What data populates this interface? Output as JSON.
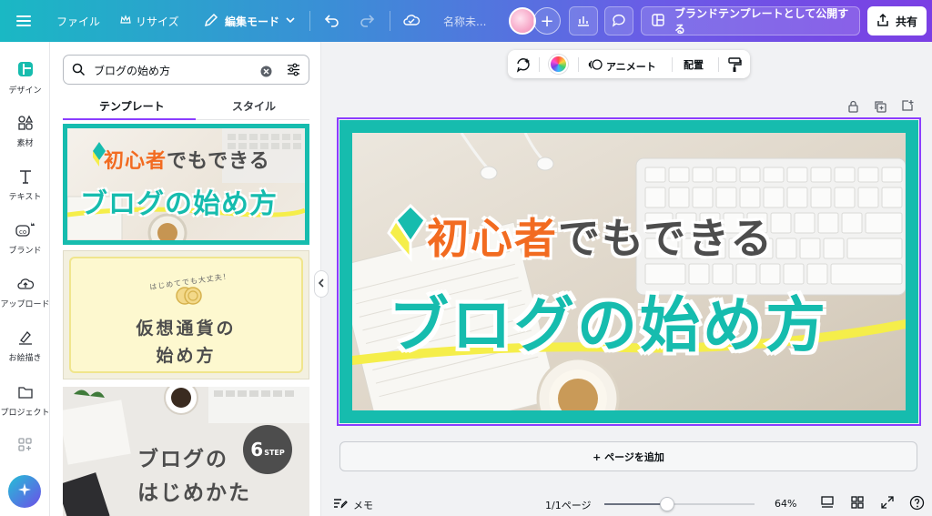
{
  "topbar": {
    "menu_label": "ファイル",
    "resize_label": "リサイズ",
    "mode_label": "編集モード",
    "doc_name": "名称未...",
    "publish_label": "ブランドテンプレートとして公開する",
    "share_label": "共有"
  },
  "rail": {
    "items": [
      {
        "label": "デザイン",
        "icon": "design-icon"
      },
      {
        "label": "素材",
        "icon": "elements-icon"
      },
      {
        "label": "テキスト",
        "icon": "text-icon"
      },
      {
        "label": "ブランド",
        "icon": "brand-icon"
      },
      {
        "label": "アップロード",
        "icon": "upload-icon"
      },
      {
        "label": "お絵描き",
        "icon": "draw-icon"
      },
      {
        "label": "プロジェクト",
        "icon": "folder-icon"
      }
    ]
  },
  "panel": {
    "search_value": "ブログの始め方",
    "tabs": [
      {
        "label": "テンプレート"
      },
      {
        "label": "スタイル"
      }
    ],
    "templates": [
      {
        "line1": "初心者でもできる",
        "line2": "ブログの始め方"
      },
      {
        "badge": "はじめてでも大丈夫！",
        "line1": "仮想通貨の",
        "line2": "始め方"
      },
      {
        "line1": "ブログの",
        "line2": "はじめかた",
        "step_num": "6",
        "step_label": "STEP"
      }
    ]
  },
  "context_bar": {
    "animate_label": "アニメート",
    "arrange_label": "配置"
  },
  "design": {
    "subtitle_hl": "初心者",
    "subtitle_rest": "でもできる",
    "title": "ブログの始め方"
  },
  "add_page_label": "+ ページを追加",
  "footer": {
    "memo_label": "メモ",
    "pages_label": "1/1ページ",
    "zoom_label": "64%",
    "zoom_value": 0.42
  },
  "colors": {
    "teal": "#16bcae",
    "orange": "#f26b21",
    "purple": "#8b3dff",
    "yellow": "#f5ee4a"
  }
}
